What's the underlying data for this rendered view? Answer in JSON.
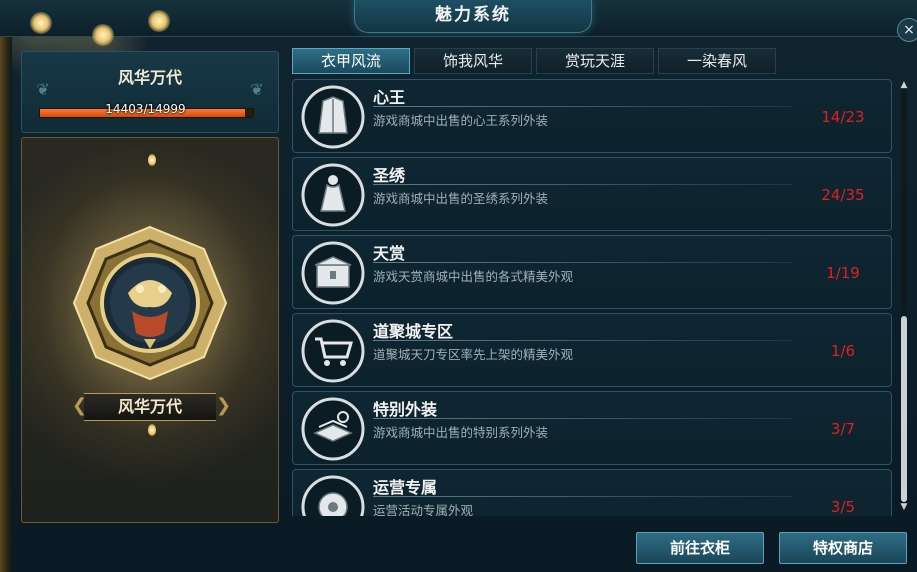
{
  "window": {
    "title": "魅力系统",
    "close_label": "×"
  },
  "profile": {
    "title": "风华万代",
    "progress_text": "14403/14999",
    "progress_current": 14403,
    "progress_max": 14999,
    "emblem_label": "风华万代",
    "progress_color": "#e05a18"
  },
  "tabs": [
    {
      "label": "衣甲风流",
      "active": true
    },
    {
      "label": "饰我风华",
      "active": false
    },
    {
      "label": "赏玩天涯",
      "active": false
    },
    {
      "label": "一染春风",
      "active": false
    }
  ],
  "items": [
    {
      "title": "心王",
      "desc": "游戏商城中出售的心王系列外装",
      "count": "14/23",
      "icon": "robe-icon"
    },
    {
      "title": "圣绣",
      "desc": "游戏商城中出售的圣绣系列外装",
      "count": "24/35",
      "icon": "dress-icon"
    },
    {
      "title": "天赏",
      "desc": "游戏天赏商城中出售的各式精美外观",
      "count": "1/19",
      "icon": "chest-icon"
    },
    {
      "title": "道聚城专区",
      "desc": "道聚城天刀专区率先上架的精美外观",
      "count": "1/6",
      "icon": "cart-icon"
    },
    {
      "title": "特别外装",
      "desc": "游戏商城中出售的特别系列外装",
      "count": "3/7",
      "icon": "folded-clothes-icon"
    },
    {
      "title": "运营专属",
      "desc": "运营活动专属外观",
      "count": "3/5",
      "icon": "gift-icon"
    }
  ],
  "buttons": {
    "wardrobe": "前往衣柜",
    "privilege_shop": "特权商店"
  },
  "colors": {
    "count_text": "#e02020",
    "accent": "#2d6f87",
    "gold": "#b89a56"
  }
}
